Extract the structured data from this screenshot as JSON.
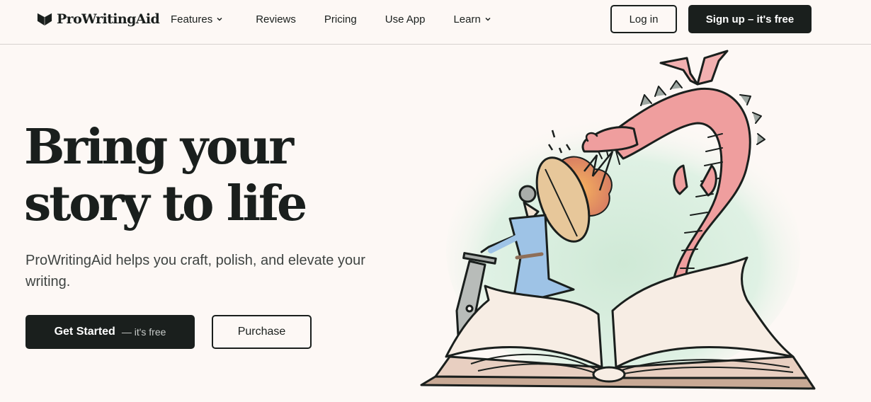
{
  "header": {
    "logo_text": "ProWritingAid",
    "logo_icon": "open-book-logo-icon",
    "nav": [
      {
        "label": "Features",
        "has_dropdown": true
      },
      {
        "label": "Reviews",
        "has_dropdown": false
      },
      {
        "label": "Pricing",
        "has_dropdown": false
      },
      {
        "label": "Use App",
        "has_dropdown": false
      },
      {
        "label": "Learn",
        "has_dropdown": true
      }
    ],
    "login_label": "Log in",
    "signup_label": "Sign up – it's free"
  },
  "hero": {
    "title_line1": "Bring your",
    "title_line2": "story to life",
    "subtitle": "ProWritingAid helps you craft, polish, and elevate your writing.",
    "cta_primary_main": "Get Started",
    "cta_primary_sub": "— it's free",
    "cta_secondary": "Purchase",
    "illustration": "Knight with pen-nib sword and shield fighting a pink fire-breathing dragon emerging from an open book"
  },
  "colors": {
    "background": "#fdf8f5",
    "primary_dark": "#1a1f1d",
    "dragon_pink": "#ef9e9e",
    "knight_blue": "#9ec3e6",
    "wash_green": "#d5ecdc",
    "fire_orange": "#f0a060"
  }
}
